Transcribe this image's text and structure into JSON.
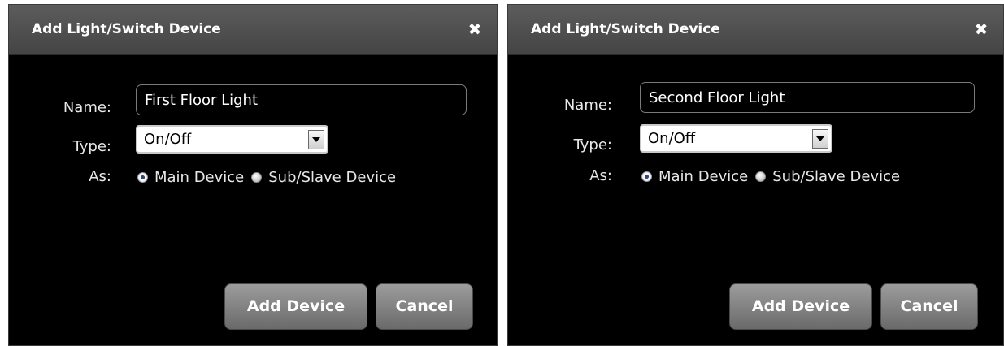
{
  "dialogs": [
    {
      "title": "Add Light/Switch Device",
      "close_glyph": "✖",
      "name_label": "Name:",
      "name_value": "First Floor Light",
      "type_label": "Type:",
      "type_value": "On/Off",
      "as_label": "As:",
      "as_options": [
        "Main Device",
        "Sub/Slave Device"
      ],
      "as_selected": "Main Device",
      "add_button": "Add Device",
      "cancel_button": "Cancel"
    },
    {
      "title": "Add Light/Switch Device",
      "close_glyph": "✖",
      "name_label": "Name:",
      "name_value": "Second Floor Light",
      "type_label": "Type:",
      "type_value": "On/Off",
      "as_label": "As:",
      "as_options": [
        "Main Device",
        "Sub/Slave Device"
      ],
      "as_selected": "Main Device",
      "add_button": "Add Device",
      "cancel_button": "Cancel"
    }
  ],
  "icons": {
    "close": "close-icon",
    "dropdown": "chevron-down-icon",
    "radio_on": "radio-selected-icon",
    "radio_off": "radio-unselected-icon"
  },
  "colors": {
    "dialog_bg": "#000000",
    "titlebar": "#4f4f4f",
    "button": "#858585",
    "text": "#ffffff"
  }
}
